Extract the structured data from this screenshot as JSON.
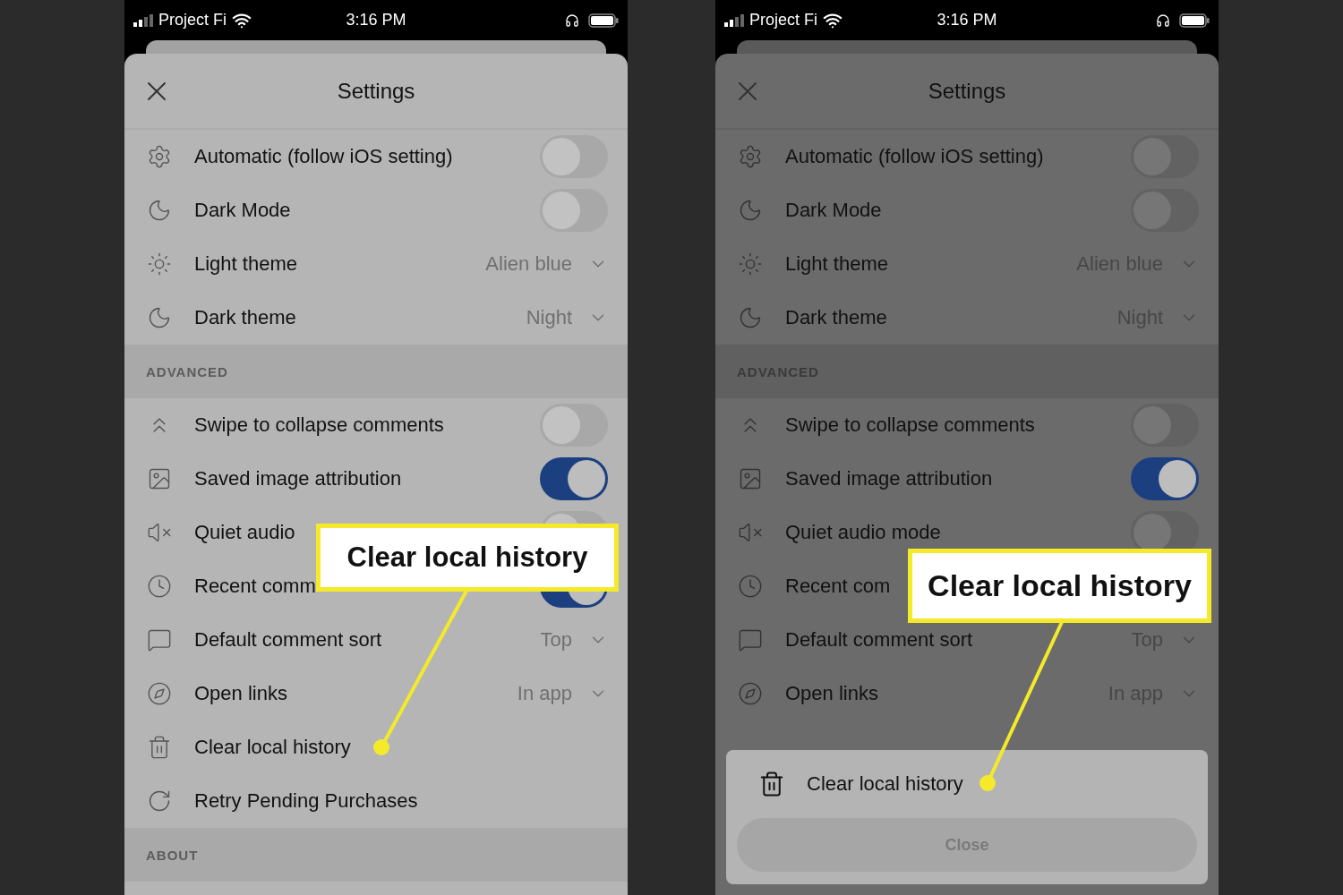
{
  "phones": [
    {
      "status_bar": {
        "carrier": "Project Fi",
        "time": "3:16 PM"
      },
      "dimmed": false,
      "title": "Settings",
      "groups": [
        {
          "rows": [
            {
              "kind": "toggle",
              "label": "Automatic (follow iOS setting)",
              "on": false
            },
            {
              "kind": "toggle",
              "label": "Dark Mode",
              "on": false
            },
            {
              "kind": "select",
              "label": "Light theme",
              "value": "Alien blue"
            },
            {
              "kind": "select",
              "label": "Dark theme",
              "value": "Night"
            }
          ]
        },
        {
          "header": "ADVANCED",
          "rows": [
            {
              "kind": "toggle",
              "label": "Swipe to collapse comments",
              "on": false
            },
            {
              "kind": "toggle",
              "label": "Saved image attribution",
              "on": true
            },
            {
              "kind": "toggle",
              "label": "Quiet audio",
              "on": false
            },
            {
              "kind": "toggle",
              "label": "Recent comm",
              "on": true
            },
            {
              "kind": "select",
              "label": "Default comment sort",
              "value": "Top"
            },
            {
              "kind": "select",
              "label": "Open links",
              "value": "In app"
            },
            {
              "kind": "action",
              "label": "Clear local history"
            },
            {
              "kind": "action",
              "label": "Retry Pending Purchases"
            }
          ]
        },
        {
          "header": "ABOUT"
        }
      ],
      "callout": {
        "text": "Clear local history"
      }
    },
    {
      "status_bar": {
        "carrier": "Project Fi",
        "time": "3:16 PM"
      },
      "dimmed": true,
      "title": "Settings",
      "groups": [
        {
          "rows": [
            {
              "kind": "toggle",
              "label": "Automatic (follow iOS setting)",
              "on": false
            },
            {
              "kind": "toggle",
              "label": "Dark Mode",
              "on": false
            },
            {
              "kind": "select",
              "label": "Light theme",
              "value": "Alien blue"
            },
            {
              "kind": "select",
              "label": "Dark theme",
              "value": "Night"
            }
          ]
        },
        {
          "header": "ADVANCED",
          "rows": [
            {
              "kind": "toggle",
              "label": "Swipe to collapse comments",
              "on": false
            },
            {
              "kind": "toggle",
              "label": "Saved image attribution",
              "on": true
            },
            {
              "kind": "toggle",
              "label": "Quiet audio mode",
              "on": false
            },
            {
              "kind": "action",
              "label": "Recent com"
            },
            {
              "kind": "select",
              "label": "Default comment sort",
              "value": "Top"
            },
            {
              "kind": "select",
              "label": "Open links",
              "value": "In app"
            }
          ]
        }
      ],
      "callout": {
        "text": "Clear local history"
      },
      "action_sheet": {
        "label": "Clear local history",
        "button": "Close"
      }
    }
  ]
}
